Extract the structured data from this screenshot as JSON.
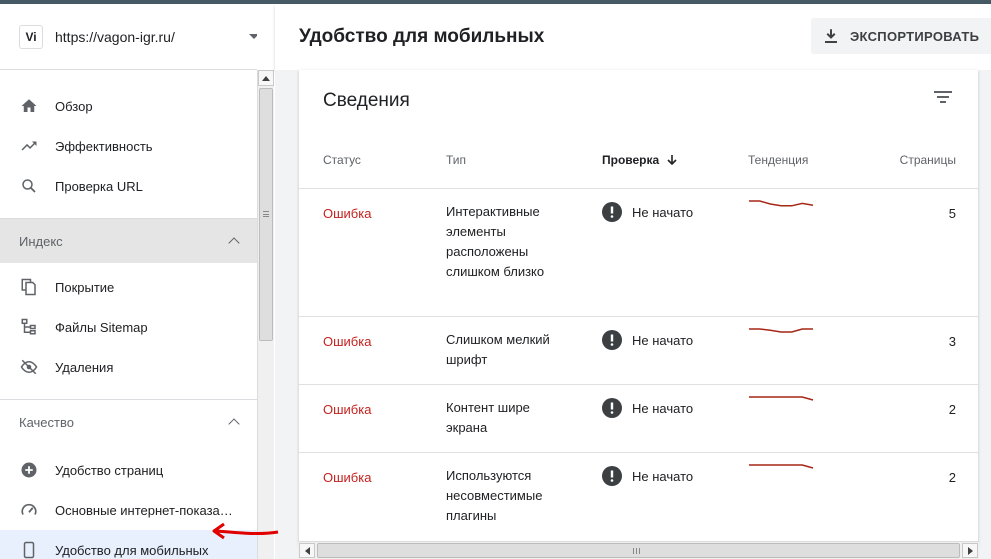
{
  "property": {
    "badge": "Vi",
    "url": "https://vagon-igr.ru/"
  },
  "sidebar": {
    "top_items": [
      {
        "label": "Обзор",
        "icon": "home-icon"
      },
      {
        "label": "Эффективность",
        "icon": "trending-up-icon"
      },
      {
        "label": "Проверка URL",
        "icon": "search-icon"
      }
    ],
    "index_section": {
      "title": "Индекс",
      "items": [
        {
          "label": "Покрытие",
          "icon": "copy-icon"
        },
        {
          "label": "Файлы Sitemap",
          "icon": "sitemap-icon"
        },
        {
          "label": "Удаления",
          "icon": "visibility-off-icon"
        }
      ]
    },
    "quality_section": {
      "title": "Качество",
      "items": [
        {
          "label": "Удобство страниц",
          "icon": "plus-circle-icon"
        },
        {
          "label": "Основные интернет-показа…",
          "icon": "gauge-icon"
        },
        {
          "label": "Удобство для мобильных",
          "icon": "smartphone-icon",
          "active": true
        }
      ]
    }
  },
  "header": {
    "title": "Удобство для мобильных",
    "export_label": "ЭКСПОРТИРОВАТЬ"
  },
  "details": {
    "title": "Сведения",
    "columns": {
      "status": "Статус",
      "type": "Тип",
      "check": "Проверка",
      "trend": "Тенденция",
      "pages": "Страницы"
    },
    "rows": [
      {
        "status": "Ошибка",
        "type": "Интерактивные элементы расположены слишком близко",
        "check": "Не начато",
        "pages": "5",
        "trend": [
          1,
          1,
          0.5,
          0.2,
          0.2,
          0.6,
          0.3
        ]
      },
      {
        "status": "Ошибка",
        "type": "Слишком мелкий шрифт",
        "check": "Не начато",
        "pages": "3",
        "trend": [
          1,
          1,
          0.8,
          0.5,
          0.5,
          1,
          1
        ]
      },
      {
        "status": "Ошибка",
        "type": "Контент шире экрана",
        "check": "Не начато",
        "pages": "2",
        "trend": [
          1,
          1,
          1,
          1,
          1,
          1,
          0.5
        ]
      },
      {
        "status": "Ошибка",
        "type": "Используются несовместимые плагины",
        "check": "Не начато",
        "pages": "2",
        "trend": [
          1,
          1,
          1,
          1,
          1,
          1,
          0.5
        ]
      }
    ]
  },
  "colors": {
    "error": "#c5221f",
    "trend": "#a52714",
    "active_nav": "#e8f0fe",
    "annotation_arrow": "#e00000"
  }
}
